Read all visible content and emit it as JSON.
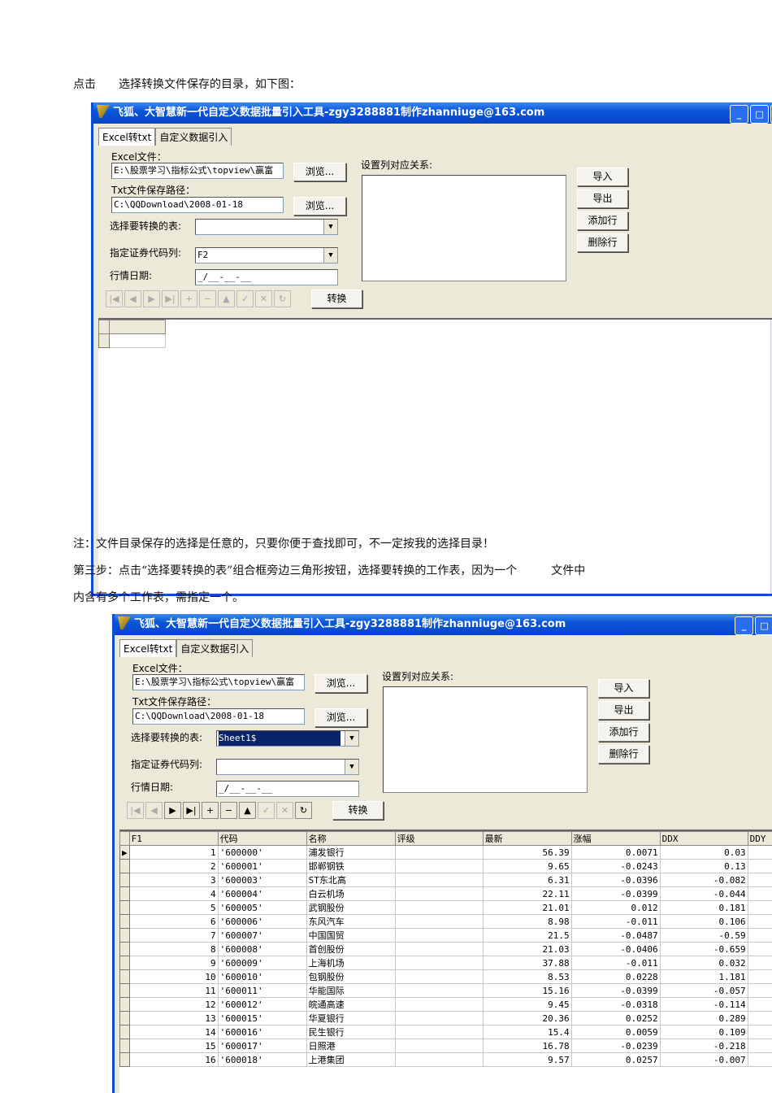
{
  "text": {
    "p1": "点击　　选择转换文件保存的目录，如下图：",
    "p2": "注：文件目录保存的选择是任意的，只要你便于查找即可，不一定按我的选择目录！",
    "p3": "第三步：点击“选择要转换的表”组合框旁边三角形按钮，选择要转换的工作表，因为一个　　　文件中",
    "p4": "内含有多个工作表，需指定一个。"
  },
  "windows": [
    {
      "title": "飞狐、大智慧新一代自定义数据批量引入工具-zgy3288881制作zhanniuge@163.com",
      "tabs": [
        "Excel转txt",
        "自定义数据引入"
      ],
      "excel_label": "Excel文件：",
      "excel_value": "E:\\股票学习\\指标公式\\topview\\赢富",
      "browse": "浏览...",
      "txt_label": "Txt文件保存路径：",
      "txt_value": "C:\\QQDownload\\2008-01-18",
      "sheet_label": "选择要转换的表:",
      "sheet_value": "",
      "code_label": "指定证券代码列:",
      "code_value": "F2",
      "date_label": "行情日期:",
      "date_value": "_/__-__-__",
      "map_label": "设置列对应关系:",
      "buttons": [
        "导入",
        "导出",
        "添加行",
        "删除行"
      ],
      "convert": "转换"
    },
    {
      "title": "飞狐、大智慧新一代自定义数据批量引入工具-zgy3288881制作zhanniuge@163.com",
      "tabs": [
        "Excel转txt",
        "自定义数据引入"
      ],
      "excel_label": "Excel文件：",
      "excel_value": "E:\\股票学习\\指标公式\\topview\\赢富",
      "browse": "浏览...",
      "txt_label": "Txt文件保存路径：",
      "txt_value": "C:\\QQDownload\\2008-01-18",
      "sheet_label": "选择要转换的表:",
      "sheet_value": "Sheet1$",
      "code_label": "指定证券代码列:",
      "code_value": "",
      "date_label": "行情日期:",
      "date_value": "_/__-__-__",
      "map_label": "设置列对应关系:",
      "buttons": [
        "导入",
        "导出",
        "添加行",
        "删除行"
      ],
      "convert": "转换"
    }
  ],
  "table": {
    "columns": [
      "F1",
      "代码",
      "名称",
      "评级",
      "最新",
      "涨幅",
      "DDX",
      "DDY"
    ],
    "rows": [
      [
        "1",
        "'600000'",
        "浦发银行",
        "",
        "56.39",
        "0.0071",
        "0.03",
        ""
      ],
      [
        "2",
        "'600001'",
        "邯郸钢铁",
        "",
        "9.65",
        "-0.0243",
        "0.13",
        ""
      ],
      [
        "3",
        "'600003'",
        "ST东北高",
        "",
        "6.31",
        "-0.0396",
        "-0.082",
        ""
      ],
      [
        "4",
        "'600004'",
        "白云机场",
        "",
        "22.11",
        "-0.0399",
        "-0.044",
        ""
      ],
      [
        "5",
        "'600005'",
        "武钢股份",
        "",
        "21.01",
        "0.012",
        "0.181",
        ""
      ],
      [
        "6",
        "'600006'",
        "东风汽车",
        "",
        "8.98",
        "-0.011",
        "0.106",
        ""
      ],
      [
        "7",
        "'600007'",
        "中国国贸",
        "",
        "21.5",
        "-0.0487",
        "-0.59",
        ""
      ],
      [
        "8",
        "'600008'",
        "首创股份",
        "",
        "21.03",
        "-0.0406",
        "-0.659",
        ""
      ],
      [
        "9",
        "'600009'",
        "上海机场",
        "",
        "37.88",
        "-0.011",
        "0.032",
        ""
      ],
      [
        "10",
        "'600010'",
        "包钢股份",
        "",
        "8.53",
        "0.0228",
        "1.181",
        ""
      ],
      [
        "11",
        "'600011'",
        "华能国际",
        "",
        "15.16",
        "-0.0399",
        "-0.057",
        ""
      ],
      [
        "12",
        "'600012'",
        "皖通高速",
        "",
        "9.45",
        "-0.0318",
        "-0.114",
        ""
      ],
      [
        "13",
        "'600015'",
        "华夏银行",
        "",
        "20.36",
        "0.0252",
        "0.289",
        ""
      ],
      [
        "14",
        "'600016'",
        "民生银行",
        "",
        "15.4",
        "0.0059",
        "0.109",
        ""
      ],
      [
        "15",
        "'600017'",
        "日照港",
        "",
        "16.78",
        "-0.0239",
        "-0.218",
        ""
      ],
      [
        "16",
        "'600018'",
        "上港集团",
        "",
        "9.57",
        "0.0257",
        "-0.007",
        ""
      ]
    ]
  }
}
